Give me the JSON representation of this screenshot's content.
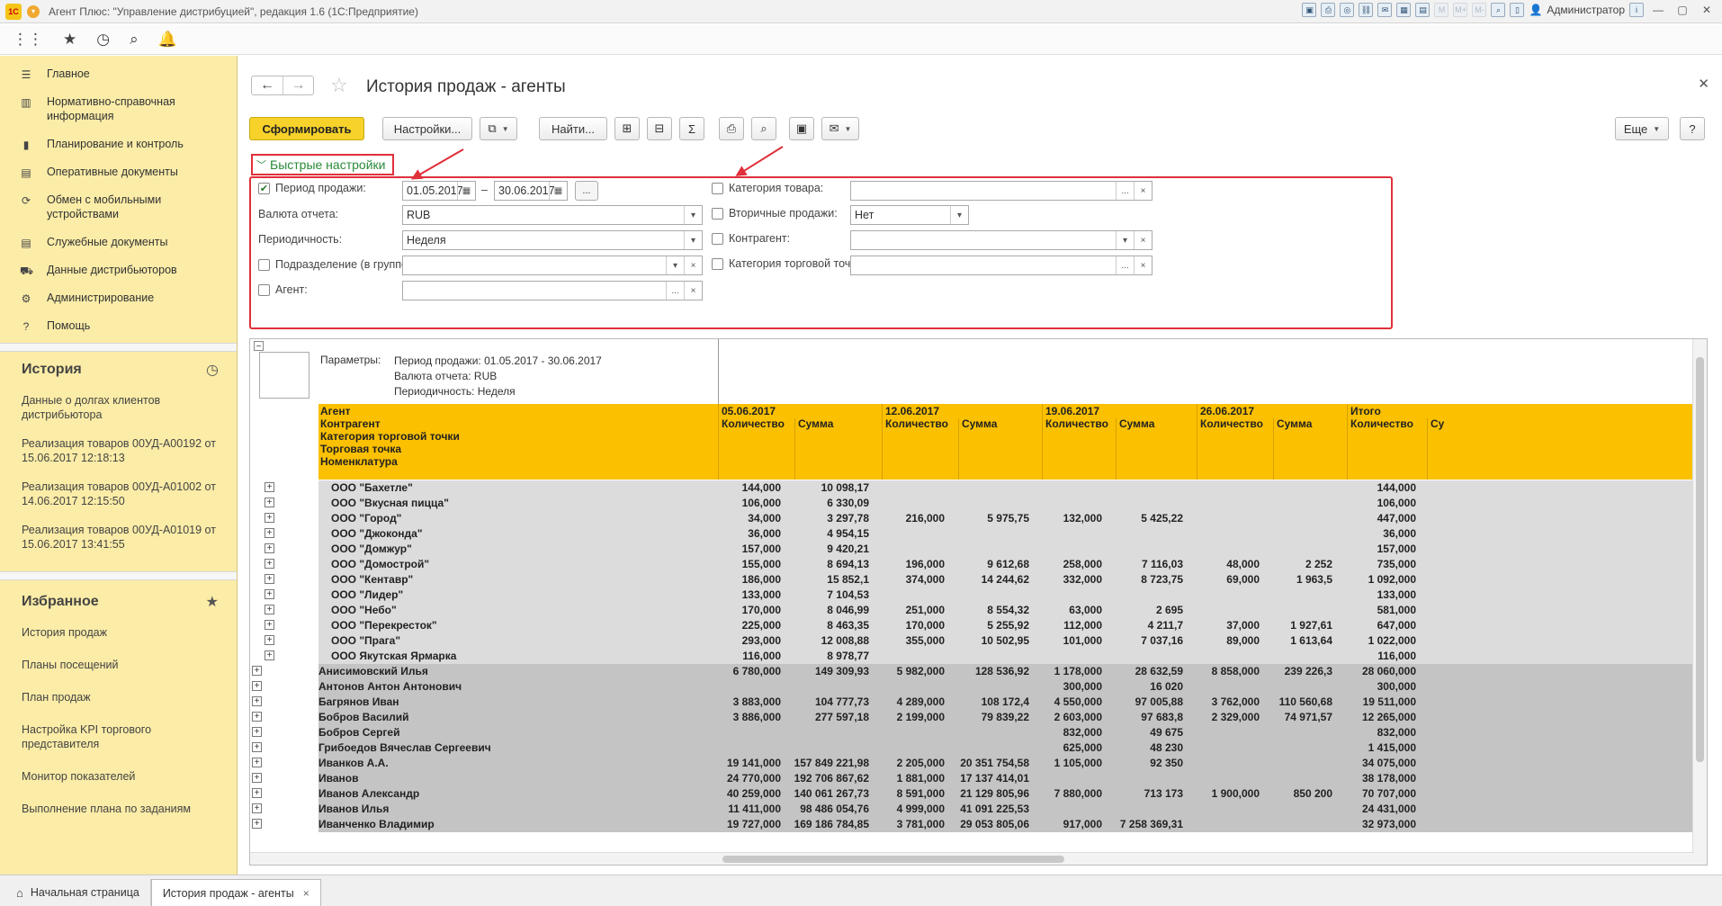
{
  "window": {
    "app_logo": "1С",
    "title": "Агент Плюс: \"Управление дистрибуцией\", редакция 1.6  (1С:Предприятие)",
    "user": "Администратор"
  },
  "sidebar": {
    "items": [
      {
        "label": "Главное",
        "icon": "menu-icon"
      },
      {
        "label": "Нормативно-справочная информация",
        "icon": "book-icon"
      },
      {
        "label": "Планирование и контроль",
        "icon": "chart-icon"
      },
      {
        "label": "Оперативные документы",
        "icon": "document-icon"
      },
      {
        "label": "Обмен с мобильными устройствами",
        "icon": "sync-icon"
      },
      {
        "label": "Служебные документы",
        "icon": "document-icon"
      },
      {
        "label": "Данные дистрибьюторов",
        "icon": "truck-icon"
      },
      {
        "label": "Администрирование",
        "icon": "gear-icon"
      },
      {
        "label": "Помощь",
        "icon": "help-icon"
      }
    ],
    "history": {
      "title": "История",
      "items": [
        "Данные о долгах клиентов дистрибьютора",
        "Реализация товаров 00УД-А00192 от 15.06.2017 12:18:13",
        "Реализация товаров 00УД-А01002 от 14.06.2017 12:15:50",
        "Реализация товаров 00УД-А01019 от 15.06.2017 13:41:55"
      ]
    },
    "favorites": {
      "title": "Избранное",
      "items": [
        "История продаж",
        "Планы посещений",
        "План продаж",
        "Настройка KPI торгового представителя",
        "Монитор показателей",
        "Выполнение плана по заданиям"
      ]
    }
  },
  "page": {
    "title": "История продаж - агенты",
    "toolbar": {
      "generate": "Сформировать",
      "settings": "Настройки...",
      "find": "Найти...",
      "more": "Еще",
      "help": "?"
    },
    "quick_settings": {
      "title": "Быстрые настройки",
      "period_label": "Период продажи:",
      "period_from": "01.05.2017",
      "period_dash": "–",
      "period_to": "30.06.2017",
      "currency_label": "Валюта отчета:",
      "currency_value": "RUB",
      "periodicity_label": "Периодичность:",
      "periodicity_value": "Неделя",
      "division_label": "Подразделение (в группе):",
      "agent_label": "Агент:",
      "category_label": "Категория товара:",
      "secondary_label": "Вторичные продажи:",
      "secondary_value": "Нет",
      "counterparty_label": "Контрагент:",
      "outlet_category_label": "Категория торговой точки:"
    }
  },
  "report": {
    "params_label": "Параметры:",
    "params": [
      "Период продажи: 01.05.2017 - 30.06.2017",
      "Валюта отчета: RUB",
      "Периодичность: Неделя"
    ],
    "row_headers": [
      "Агент",
      "Контрагент",
      "Категория торговой точки",
      "Торговая точка",
      "Номенклатура"
    ],
    "periods": [
      "05.06.2017",
      "12.06.2017",
      "19.06.2017",
      "26.06.2017",
      "Итого"
    ],
    "col_qty": "Количество",
    "col_sum": "Сумма",
    "col_sum_cut": "Су",
    "rows": [
      {
        "level": 2,
        "name": "ООО \"Бахетле\"",
        "v": [
          "144,000",
          "10 098,17",
          "",
          "",
          "",
          "",
          "",
          "",
          "144,000"
        ]
      },
      {
        "level": 2,
        "name": "ООО \"Вкусная пицца\"",
        "v": [
          "106,000",
          "6 330,09",
          "",
          "",
          "",
          "",
          "",
          "",
          "106,000"
        ]
      },
      {
        "level": 2,
        "name": "ООО \"Город\"",
        "v": [
          "34,000",
          "3 297,78",
          "216,000",
          "5 975,75",
          "132,000",
          "5 425,22",
          "",
          "",
          "447,000"
        ]
      },
      {
        "level": 2,
        "name": "ООО \"Джоконда\"",
        "v": [
          "36,000",
          "4 954,15",
          "",
          "",
          "",
          "",
          "",
          "",
          "36,000"
        ]
      },
      {
        "level": 2,
        "name": "ООО \"Домжур\"",
        "v": [
          "157,000",
          "9 420,21",
          "",
          "",
          "",
          "",
          "",
          "",
          "157,000"
        ]
      },
      {
        "level": 2,
        "name": "ООО \"Домострой\"",
        "v": [
          "155,000",
          "8 694,13",
          "196,000",
          "9 612,68",
          "258,000",
          "7 116,03",
          "48,000",
          "2 252",
          "735,000"
        ]
      },
      {
        "level": 2,
        "name": "ООО \"Кентавр\"",
        "v": [
          "186,000",
          "15 852,1",
          "374,000",
          "14 244,62",
          "332,000",
          "8 723,75",
          "69,000",
          "1 963,5",
          "1 092,000"
        ]
      },
      {
        "level": 2,
        "name": "ООО \"Лидер\"",
        "v": [
          "133,000",
          "7 104,53",
          "",
          "",
          "",
          "",
          "",
          "",
          "133,000"
        ]
      },
      {
        "level": 2,
        "name": "ООО \"Небо\"",
        "v": [
          "170,000",
          "8 046,99",
          "251,000",
          "8 554,32",
          "63,000",
          "2 695",
          "",
          "",
          "581,000"
        ]
      },
      {
        "level": 2,
        "name": "ООО \"Перекресток\"",
        "v": [
          "225,000",
          "8 463,35",
          "170,000",
          "5 255,92",
          "112,000",
          "4 211,7",
          "37,000",
          "1 927,61",
          "647,000"
        ]
      },
      {
        "level": 2,
        "name": "ООО \"Прага\"",
        "v": [
          "293,000",
          "12 008,88",
          "355,000",
          "10 502,95",
          "101,000",
          "7 037,16",
          "89,000",
          "1 613,64",
          "1 022,000"
        ]
      },
      {
        "level": 2,
        "name": "ООО Якутская Ярмарка",
        "v": [
          "116,000",
          "8 978,77",
          "",
          "",
          "",
          "",
          "",
          "",
          "116,000"
        ]
      },
      {
        "level": 1,
        "name": "Анисимовский Илья",
        "v": [
          "6 780,000",
          "149 309,93",
          "5 982,000",
          "128 536,92",
          "1 178,000",
          "28 632,59",
          "8 858,000",
          "239 226,3",
          "28 060,000"
        ]
      },
      {
        "level": 1,
        "name": "Антонов Антон Антонович",
        "v": [
          "",
          "",
          "",
          "",
          "300,000",
          "16 020",
          "",
          "",
          "300,000"
        ]
      },
      {
        "level": 1,
        "name": "Багрянов Иван",
        "v": [
          "3 883,000",
          "104 777,73",
          "4 289,000",
          "108 172,4",
          "4 550,000",
          "97 005,88",
          "3 762,000",
          "110 560,68",
          "19 511,000"
        ]
      },
      {
        "level": 1,
        "name": "Бобров Василий",
        "v": [
          "3 886,000",
          "277 597,18",
          "2 199,000",
          "79 839,22",
          "2 603,000",
          "97 683,8",
          "2 329,000",
          "74 971,57",
          "12 265,000"
        ]
      },
      {
        "level": 1,
        "name": "Бобров Сергей",
        "v": [
          "",
          "",
          "",
          "",
          "832,000",
          "49 675",
          "",
          "",
          "832,000"
        ]
      },
      {
        "level": 1,
        "name": "Грибоедов Вячеслав Сергеевич",
        "v": [
          "",
          "",
          "",
          "",
          "625,000",
          "48 230",
          "",
          "",
          "1 415,000"
        ]
      },
      {
        "level": 1,
        "name": "Иванков А.А.",
        "v": [
          "19 141,000",
          "157 849 221,98",
          "2 205,000",
          "20 351 754,58",
          "1 105,000",
          "92 350",
          "",
          "",
          "34 075,000"
        ]
      },
      {
        "level": 1,
        "name": "Иванов",
        "v": [
          "24 770,000",
          "192 706 867,62",
          "1 881,000",
          "17 137 414,01",
          "",
          "",
          "",
          "",
          "38 178,000"
        ]
      },
      {
        "level": 1,
        "name": "Иванов Александр",
        "v": [
          "40 259,000",
          "140 061 267,73",
          "8 591,000",
          "21 129 805,96",
          "7 880,000",
          "713 173",
          "1 900,000",
          "850 200",
          "70 707,000"
        ]
      },
      {
        "level": 1,
        "name": "Иванов Илья",
        "v": [
          "11 411,000",
          "98 486 054,76",
          "4 999,000",
          "41 091 225,53",
          "",
          "",
          "",
          "",
          "24 431,000"
        ]
      },
      {
        "level": 1,
        "name": "Иванченко Владимир",
        "v": [
          "19 727,000",
          "169 186 784,85",
          "3 781,000",
          "29 053 805,06",
          "917,000",
          "7 258 369,31",
          "",
          "",
          "32 973,000"
        ]
      }
    ]
  },
  "tabs": [
    {
      "label": "Начальная страница",
      "icon": "home-icon"
    },
    {
      "label": "История продаж - агенты",
      "close": "×"
    }
  ]
}
